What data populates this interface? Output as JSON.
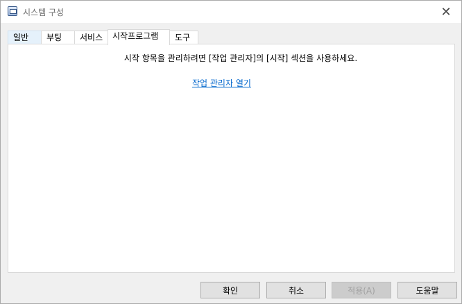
{
  "window": {
    "title": "시스템 구성",
    "close_glyph": "✕"
  },
  "tabs": [
    {
      "label": "일반"
    },
    {
      "label": "부팅"
    },
    {
      "label": "서비스"
    },
    {
      "label": "시작프로그램",
      "selected": true
    },
    {
      "label": "도구"
    }
  ],
  "panel": {
    "message": "시작 항목을 관리하려면 [작업 관리자]의 [시작] 섹션을 사용하세요.",
    "link": "작업 관리자 열기"
  },
  "buttons": {
    "ok": "확인",
    "cancel": "취소",
    "apply": "적용(A)",
    "help": "도움말"
  },
  "colors": {
    "link": "#0066cc",
    "selected_tab_highlight": "#e5f1fb"
  }
}
